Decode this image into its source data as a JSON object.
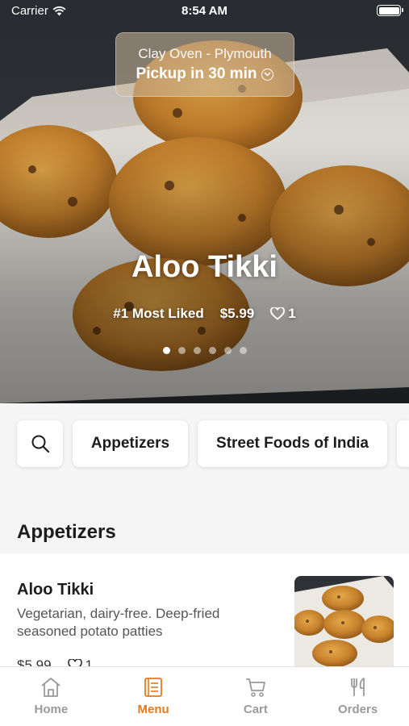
{
  "status": {
    "carrier": "Carrier",
    "time": "8:54 AM"
  },
  "location": {
    "name": "Clay Oven - Plymouth",
    "pickup": "Pickup in 30 min"
  },
  "featured": {
    "title": "Aloo Tikki",
    "rank": "#1 Most Liked",
    "price": "$5.99",
    "likes": "1",
    "slide_count": 6,
    "active_slide": 0
  },
  "categories": [
    "Appetizers",
    "Street Foods of India"
  ],
  "section": {
    "title": "Appetizers"
  },
  "item": {
    "name": "Aloo Tikki",
    "description": "Vegetarian, dairy-free. Deep-fried seasoned potato patties",
    "price": "$5.99",
    "likes": "1"
  },
  "tabs": [
    {
      "label": "Home",
      "icon": "home-icon"
    },
    {
      "label": "Menu",
      "icon": "menu-book-icon",
      "active": true
    },
    {
      "label": "Cart",
      "icon": "cart-icon"
    },
    {
      "label": "Orders",
      "icon": "fork-knife-icon"
    }
  ],
  "colors": {
    "accent": "#e8781a",
    "inactive_tab": "#9a9a9a",
    "background": "#f5f5f5"
  }
}
